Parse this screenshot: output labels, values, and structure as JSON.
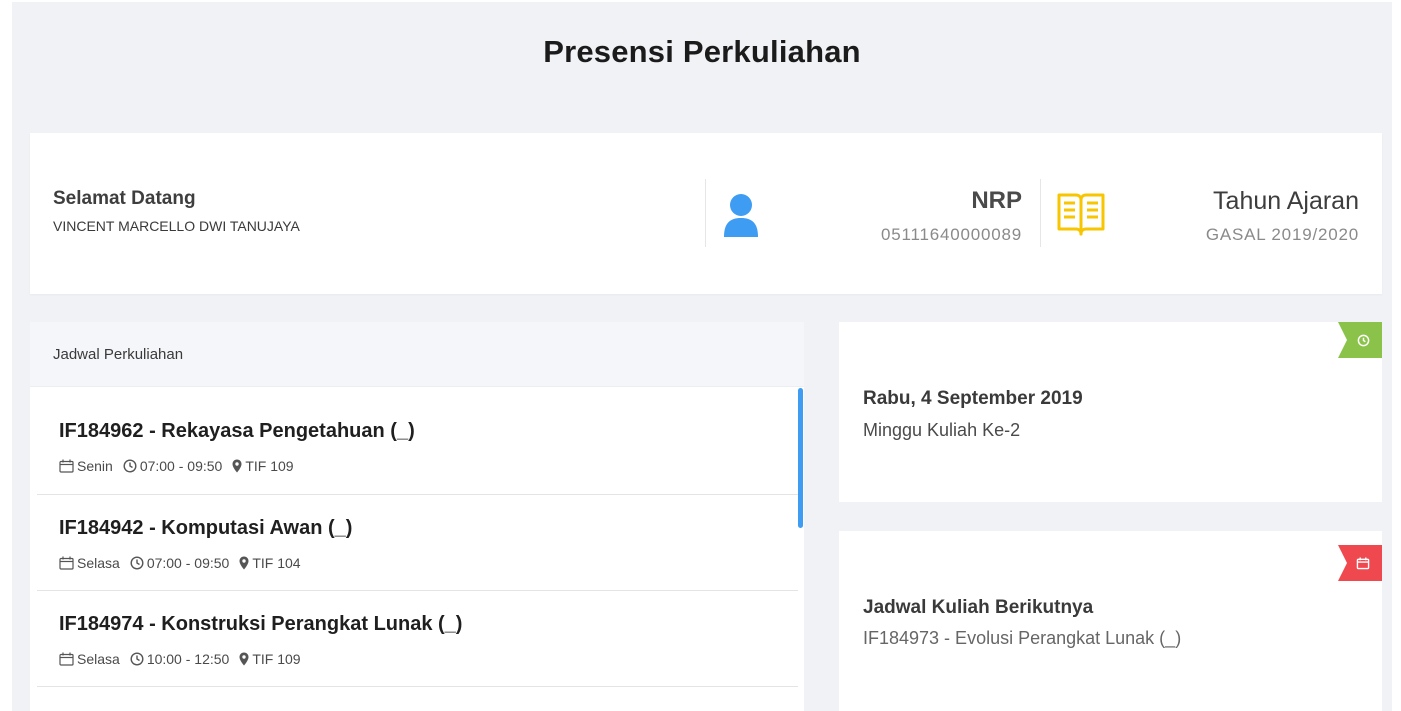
{
  "page": {
    "title": "Presensi Perkuliahan"
  },
  "info": {
    "welcome_title": "Selamat Datang",
    "student_name": "VINCENT MARCELLO DWI TANUJAYA",
    "nrp_label": "NRP",
    "nrp_value": "05111640000089",
    "year_label": "Tahun Ajaran",
    "year_value": "GASAL 2019/2020",
    "user_icon": "user-icon",
    "book_icon": "book-icon",
    "colors": {
      "user_icon": "#3e9df3",
      "book_icon": "#f7c600"
    }
  },
  "schedule": {
    "header": "Jadwal Perkuliahan",
    "items": [
      {
        "title": "IF184962 - Rekayasa Pengetahuan (_)",
        "day": "Senin",
        "time": "07:00 - 09:50",
        "room": "TIF 109"
      },
      {
        "title": "IF184942 - Komputasi Awan (_)",
        "day": "Selasa",
        "time": "07:00 - 09:50",
        "room": "TIF 104"
      },
      {
        "title": "IF184974 - Konstruksi Perangkat Lunak (_)",
        "day": "Selasa",
        "time": "10:00 - 12:50",
        "room": "TIF 109"
      }
    ],
    "scrollbar_color": "#3e9df3"
  },
  "today": {
    "date": "Rabu, 4 September 2019",
    "week": "Minggu Kuliah Ke-2",
    "ribbon_icon": "clock-icon",
    "ribbon_color": "#8bc34a"
  },
  "next": {
    "title": "Jadwal Kuliah Berikutnya",
    "course": "IF184973 - Evolusi Perangkat Lunak (_)",
    "ribbon_icon": "calendar-icon",
    "ribbon_color": "#f0484f"
  }
}
